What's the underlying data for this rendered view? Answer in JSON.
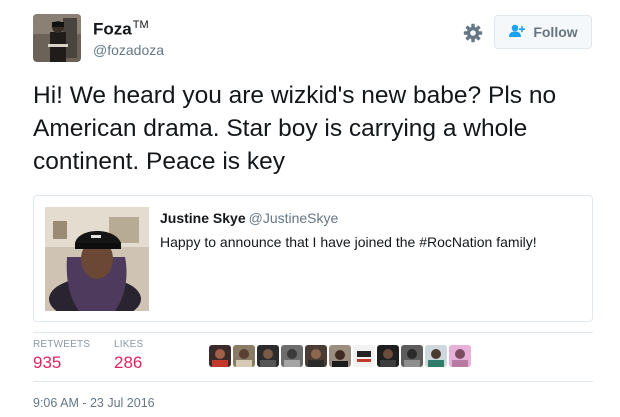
{
  "author": {
    "name": "Foza",
    "trademark": "TM",
    "handle": "@fozadoza"
  },
  "header": {
    "follow_label": "Follow",
    "settings_icon": "gear-icon",
    "follow_icon": "add-user-icon"
  },
  "tweet": {
    "text": "Hi! We heard you are wizkid's new babe? Pls no American drama. Star boy is carrying a whole continent. Peace is key"
  },
  "quoted_tweet": {
    "name": "Justine Skye",
    "handle": "@JustineSkye",
    "text": "Happy to announce that I have joined the #RocNation family!"
  },
  "stats": {
    "retweets_label": "RETWEETS",
    "retweets_count": "935",
    "likes_label": "LIKES",
    "likes_count": "286"
  },
  "liker_avatars": [
    "liker-avatar-1",
    "liker-avatar-2",
    "liker-avatar-3",
    "liker-avatar-4",
    "liker-avatar-5",
    "liker-avatar-6",
    "liker-avatar-7",
    "liker-avatar-8",
    "liker-avatar-9",
    "liker-avatar-10",
    "liker-avatar-11"
  ],
  "timestamp": "9:06 AM - 23 Jul 2016",
  "colors": {
    "text": "#14171a",
    "secondary": "#657786",
    "like_count": "#e0245e",
    "border": "#e1e8ed"
  }
}
